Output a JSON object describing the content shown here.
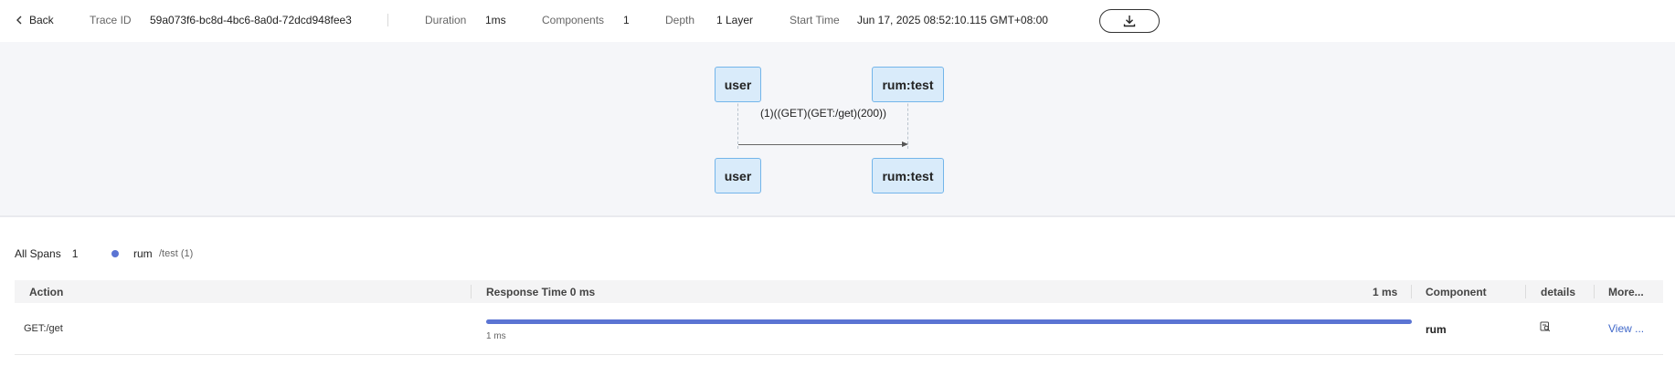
{
  "header": {
    "back_label": "Back",
    "trace_id_label": "Trace ID",
    "trace_id": "59a073f6-bc8d-4bc6-8a0d-72dcd948fee3",
    "duration_label": "Duration",
    "duration": "1ms",
    "components_label": "Components",
    "components": "1",
    "depth_label": "Depth",
    "depth": "1 Layer",
    "start_time_label": "Start Time",
    "start_time": "Jun 17, 2025 08:52:10.115 GMT+08:00",
    "download_icon": "download-icon"
  },
  "diagram": {
    "actors": [
      {
        "top": "user",
        "bottom": "user"
      },
      {
        "top": "rum:test",
        "bottom": "rum:test"
      }
    ],
    "message": "(1)((GET)(GET:/get)(200))"
  },
  "spans": {
    "all_label": "All Spans",
    "count": "1",
    "service": "rum",
    "path": "/test (1)",
    "dot_color": "#5b74d3"
  },
  "table": {
    "headers": {
      "action": "Action",
      "response_time": "Response Time 0 ms",
      "response_time_max": "1 ms",
      "component": "Component",
      "details": "details",
      "more": "More..."
    },
    "rows": [
      {
        "action": "GET:/get",
        "response_fraction": 1.0,
        "response_label": "1 ms",
        "component": "rum",
        "details_icon": "details-search-icon",
        "more": "View ..."
      }
    ]
  }
}
